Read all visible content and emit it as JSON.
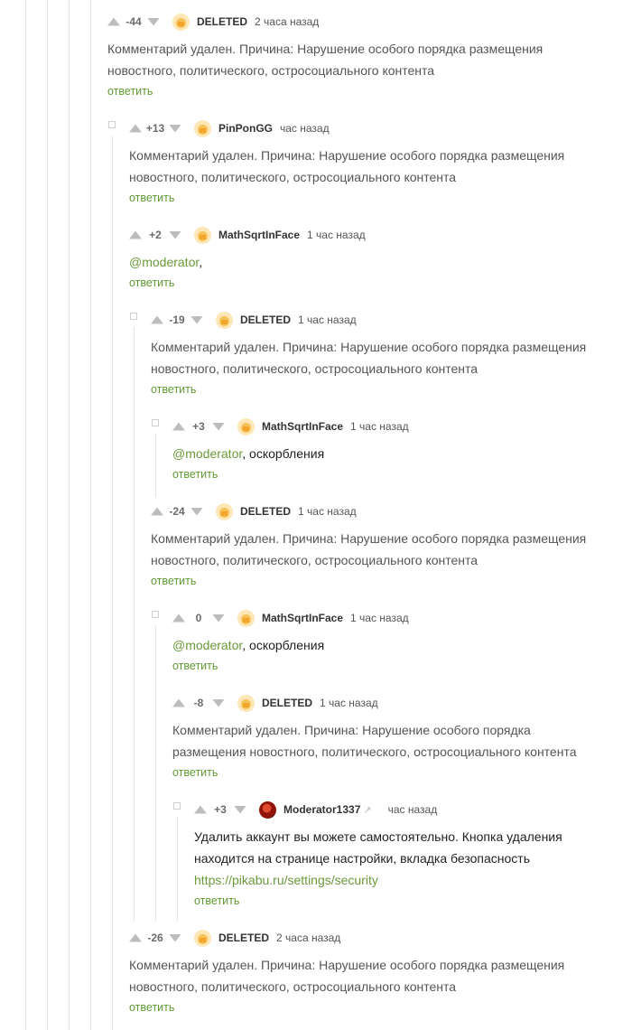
{
  "labels": {
    "reply": "ответить"
  },
  "deleted_text": "Комментарий удален. Причина: Нарушение особого порядка размещения новостного, политического, остросоциального контента",
  "deleted_text_lines": [
    "Комментарий удален. Причина: Нарушение особого порядка размещения",
    "новостного, политического, остросоциального контента"
  ],
  "deleted_text_lines_narrow": [
    "Комментарий удален. Причина: Нарушение особого порядка",
    "размещения новостного, политического, остросоциального контента"
  ],
  "comments": [
    {
      "rating": "-44",
      "author": "DELETED",
      "time": "2 часа назад"
    },
    {
      "rating": "+13",
      "author": "PinPonGG",
      "time": "час назад"
    },
    {
      "rating": "+2",
      "author": "MathSqrtInFace",
      "time": "1 час назад",
      "mention": "@moderator",
      "rest": ","
    },
    {
      "rating": "-19",
      "author": "DELETED",
      "time": "1 час назад"
    },
    {
      "rating": "+3",
      "author": "MathSqrtInFace",
      "time": "1 час назад",
      "mention": "@moderator",
      "rest": ", оскорбления"
    },
    {
      "rating": "-24",
      "author": "DELETED",
      "time": "1 час назад"
    },
    {
      "rating": "0",
      "author": "MathSqrtInFace",
      "time": "1 час назад",
      "mention": "@moderator",
      "rest": ", оскорбления"
    },
    {
      "rating": "-8",
      "author": "DELETED",
      "time": "1 час назад"
    },
    {
      "rating": "+3",
      "author": "Moderator1337",
      "time": "час назад",
      "lines": [
        "Удалить аккаунт вы можете самостоятельно. Кнопка удаления",
        "находится на странице настройки, вкладка безопасность"
      ],
      "link": "https://pikabu.ru/settings/security"
    },
    {
      "rating": "-26",
      "author": "DELETED",
      "time": "2 часа назад"
    }
  ]
}
